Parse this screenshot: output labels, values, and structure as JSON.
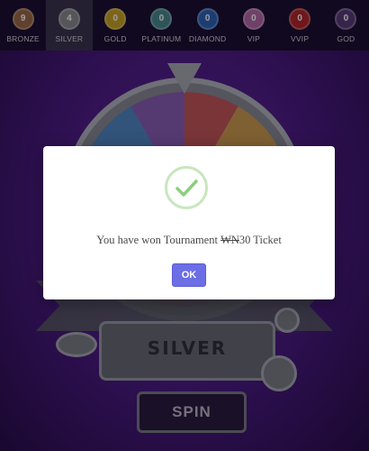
{
  "tiers": [
    {
      "label": "BRONZE",
      "count": "9",
      "color": "#9b6a4a"
    },
    {
      "label": "SILVER",
      "count": "4",
      "color": "#8a8a92",
      "active": true
    },
    {
      "label": "GOLD",
      "count": "0",
      "color": "#c9a227"
    },
    {
      "label": "PLATINUM",
      "count": "0",
      "color": "#4a8a90"
    },
    {
      "label": "DIAMOND",
      "count": "0",
      "color": "#2f63b8"
    },
    {
      "label": "VIP",
      "count": "0",
      "color": "#b56aa8"
    },
    {
      "label": "VVIP",
      "count": "0",
      "color": "#b3262b"
    },
    {
      "label": "GOD",
      "count": "0",
      "color": "#5a3a7a"
    }
  ],
  "game": {
    "wheel_tier_label": "SILVER",
    "spin_label": "SPIN"
  },
  "dialog": {
    "message_prefix": "You have won Tournament ",
    "currency_symbol": "₩N",
    "message_suffix": "30 Ticket",
    "ok_label": "OK",
    "icon": "check-icon",
    "accent_color": "#6c6ee6",
    "check_color": "#8ccf7e"
  }
}
